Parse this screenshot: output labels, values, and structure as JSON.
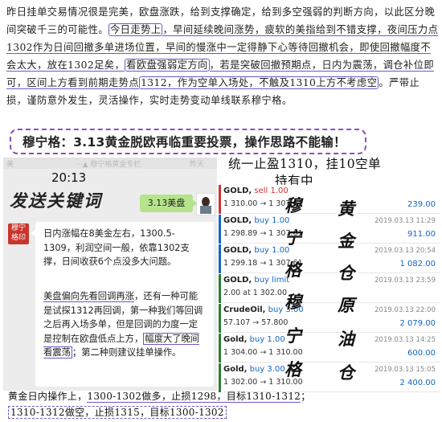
{
  "article": {
    "seg1": "昨日挂单交易情况很是完美，欧盘涨跌，给到支撑确定，给到多空强弱的判断方向，以此区分晚间突破千三的可能性。",
    "seg2": "今日走势上",
    "seg3": "，早间延续晚间涨势，疲软的美指给到不错支撑，夜间压力点1302作为日间回撤多单进场位置，早间的慢涨中一定得静下心等待回撤机会，即使回撤幅度不会太大，放在1302足矣，",
    "seg4": "看欧盘强弱定方向",
    "seg5": "，若是突破回撤预期点，日内为震荡，调仓补位即可，区间上方看到前期走势点",
    "seg6": "1312，作为空单入场处，不触及1310上方不考虑空",
    "seg7": "。严带止损，谨防意外发生，灵活操作，实时走势变动单线联系穆宁格。"
  },
  "banner": {
    "text": "穆宁格：3.13黄金脱欧再临重要投票，操作思路不能输！"
  },
  "chat": {
    "topbar_left": "美",
    "topbar_mid": "···▲ 穆宁格黄金专栏",
    "topbar_right": "昨天",
    "time": "20:13",
    "title": "发送关键词",
    "tag": "3.13美盘",
    "seal": "穆宁格印",
    "p1": "日内涨幅在8美金左右，1300.5-1309，利润空间一般，依靠1302支撑，日间收获6个点没多大问题。",
    "p2a": "美盘偏向先看回调再涨",
    "p2b": "，还有一种可能是试探1312再回调，第一种我们等回调之后再入场多单，但是回调的力度一定是控制在欧盘低点上方，",
    "p2c": "幅度大了晚间看震荡",
    "p2d": "；第二种则建议挂单操作。"
  },
  "trades": {
    "header1": "统一止盈1310，挂10空单",
    "header2": "持有中",
    "rows": [
      {
        "symbol": "GOLD,",
        "side": "sell 1.00",
        "side_color": "#d32f2f",
        "bar": "#d32f2f",
        "prices": "1 310.00 → 1 307.61",
        "date": "",
        "pl": "239.00"
      },
      {
        "symbol": "GOLD,",
        "side": "buy 1.00",
        "side_color": "#1565c0",
        "bar": "#1565c0",
        "prices": "1 298.89 → 1 307.61",
        "date": "2019.03.13 11:29",
        "pl": "911.00"
      },
      {
        "symbol": "GOLD,",
        "side": "buy 1.00",
        "side_color": "#1565c0",
        "bar": "#1565c0",
        "prices": "1 299.18 → 1 307.61",
        "date": "2019.03.13 20:54",
        "pl": "1 082.00"
      },
      {
        "symbol": "GOLD,",
        "side": "buy limit",
        "side_color": "#1565c0",
        "bar": "#2e7d32",
        "prices": "2.00 at 1 302.00",
        "date": "2019.03.13 23:59",
        "pl": ""
      },
      {
        "symbol": "CrudeOil,",
        "side": "buy 3.00",
        "side_color": "#1565c0",
        "bar": "#2e7d32",
        "prices": "57.107 → 57.800",
        "date": "2019.03.13 22:00",
        "pl": "2 079.00"
      },
      {
        "symbol": "Gold,",
        "side": "buy 1.00",
        "side_color": "#1565c0",
        "bar": "#2e7d32",
        "prices": "1 304.00 → 1 310.00",
        "date": "2019.03.13 14:25",
        "pl": "600.00"
      },
      {
        "symbol": "Gold,",
        "side": "buy 3.00",
        "side_color": "#1565c0",
        "bar": "#2e7d32",
        "prices": "1 302.00 → 1 310.00",
        "date": "2019.03.13 15:05",
        "pl": "2 400.00"
      }
    ],
    "ink": {
      "c1": [
        "穆",
        "宁",
        "格",
        "穆",
        "宁",
        "格"
      ],
      "c2": [
        "黄",
        "金",
        "仓",
        "原",
        "油",
        "仓"
      ]
    }
  },
  "footer": {
    "line1a": "黄金日内操作上，",
    "line1b": "1300-1302做多，止损1298，目标1310-1312",
    "line1c": "；",
    "line2": "1310-1312做空，止损1315，目标1300-1302"
  }
}
